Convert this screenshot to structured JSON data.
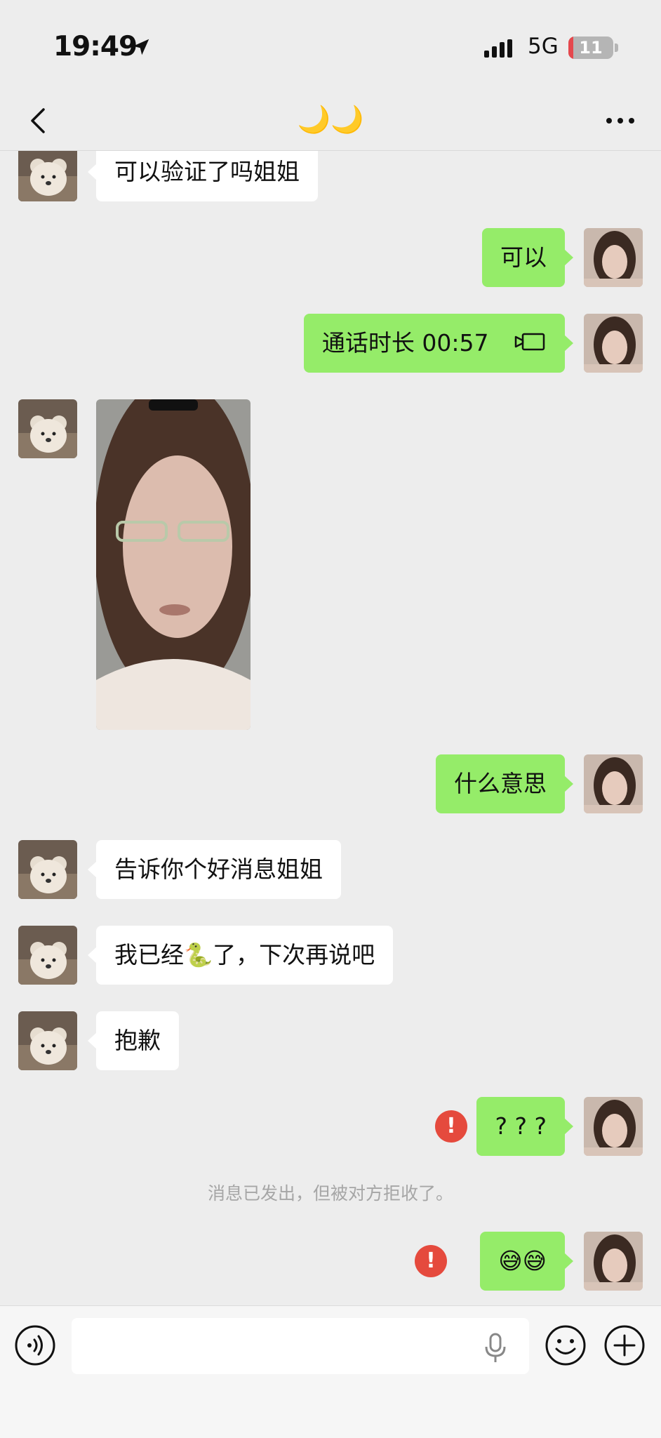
{
  "status_bar": {
    "time": "19:49",
    "network": "5G",
    "battery": "11",
    "battery_level_percent": 11
  },
  "nav": {
    "title": "🌙🌙",
    "back_icon": "chevron-left-icon",
    "more_icon": "more-dots-icon"
  },
  "messages": [
    {
      "side": "in",
      "text": "可以验证了吗姐姐"
    },
    {
      "side": "out",
      "text": "可以"
    },
    {
      "side": "out",
      "type": "call",
      "text": "通话时长 00:57"
    },
    {
      "side": "in",
      "type": "image"
    },
    {
      "side": "out",
      "text": "什么意思"
    },
    {
      "side": "in",
      "text": "告诉你个好消息姐姐"
    },
    {
      "side": "in",
      "text": "我已经🐍了，下次再说吧"
    },
    {
      "side": "in",
      "text": "抱歉"
    },
    {
      "side": "out",
      "text": "? ? ?",
      "failed": true
    },
    {
      "type": "system",
      "text": "消息已发出，但被对方拒收了。"
    },
    {
      "side": "out",
      "text": "😅😅",
      "failed": true
    }
  ],
  "error_mark": "!",
  "input": {
    "voice_icon": "voice-icon",
    "mic_icon": "mic-icon",
    "emoji_icon": "emoji-icon",
    "plus_icon": "plus-icon"
  },
  "colors": {
    "sent_bubble": "#95ec69",
    "received_bubble": "#ffffff",
    "error": "#e54a3d",
    "background": "#ededed"
  }
}
